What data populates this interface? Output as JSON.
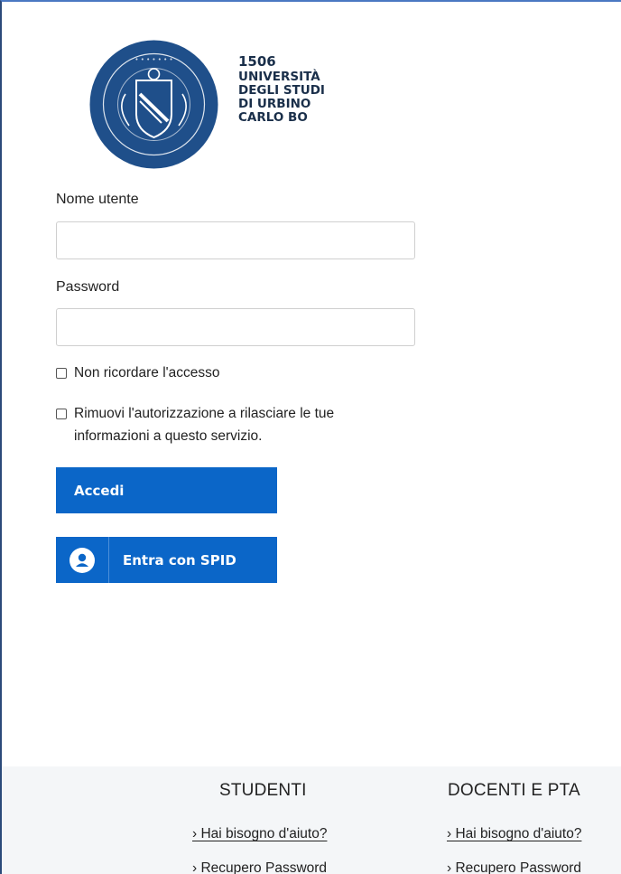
{
  "logo": {
    "year": "1506",
    "line1": "UNIVERSITÀ",
    "line2": "DEGLI STUDI",
    "line3": "DI URBINO",
    "line4": "CARLO BO",
    "seal_color": "#1f4f8a",
    "seal_icon": "university-seal-icon"
  },
  "form": {
    "username_label": "Nome utente",
    "username_value": "",
    "password_label": "Password",
    "password_value": "",
    "checkbox1_label": "Non ricordare l'accesso",
    "checkbox2_label": "Rimuovi l'autorizzazione a rilasciare le tue informazioni a questo servizio.",
    "login_button": "Accedi",
    "spid_button": "Entra con SPID",
    "spid_icon": "user-circle-icon",
    "accent_color": "#0b66c8"
  },
  "footer": {
    "students": {
      "heading": "STUDENTI",
      "links": [
        "› Hai bisogno d'aiuto?",
        "› Recupero Password"
      ]
    },
    "staff": {
      "heading": "DOCENTI E PTA",
      "links": [
        "› Hai bisogno d'aiuto?",
        "› Recupero Password"
      ]
    }
  }
}
